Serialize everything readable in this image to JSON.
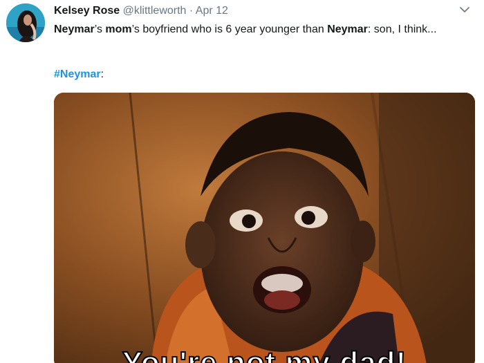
{
  "user": {
    "display_name": "Kelsey Rose",
    "handle": "@klittleworth",
    "separator": "·",
    "date": "Apr 12"
  },
  "tweet": {
    "parts": [
      "Neymar",
      "’s ",
      "mom",
      "’s boyfriend who is 6 year younger than ",
      "Neymar",
      ": son, I think..."
    ],
    "hashtag": "#Neymar",
    "hashtag_suffix": ":"
  },
  "media": {
    "caption": "You're not my dad!"
  },
  "icons": {
    "menu": "chevron-down-icon"
  },
  "colors": {
    "link": "#1b95e0",
    "text": "#14171a",
    "secondary": "#657786"
  }
}
